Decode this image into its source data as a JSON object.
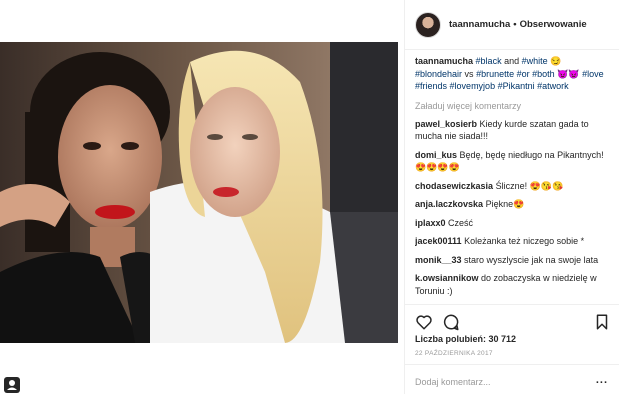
{
  "header": {
    "username": "taannamucha",
    "separator": "•",
    "follow_label": "Obserwowanie"
  },
  "caption": {
    "username": "taannamucha",
    "parts": [
      {
        "t": "tag",
        "v": "#black"
      },
      {
        "t": "text",
        "v": " and "
      },
      {
        "t": "tag",
        "v": "#white"
      },
      {
        "t": "text",
        "v": " 😏 "
      },
      {
        "t": "tag",
        "v": "#blondehair"
      },
      {
        "t": "text",
        "v": " vs "
      },
      {
        "t": "tag",
        "v": "#brunette"
      },
      {
        "t": "text",
        "v": " "
      },
      {
        "t": "tag",
        "v": "#or"
      },
      {
        "t": "text",
        "v": " "
      },
      {
        "t": "tag",
        "v": "#both"
      },
      {
        "t": "text",
        "v": " 😈👿 "
      },
      {
        "t": "tag",
        "v": "#love"
      },
      {
        "t": "text",
        "v": " "
      },
      {
        "t": "tag",
        "v": "#friends"
      },
      {
        "t": "text",
        "v": " "
      },
      {
        "t": "tag",
        "v": "#lovemyjob"
      },
      {
        "t": "text",
        "v": " "
      },
      {
        "t": "tag",
        "v": "#Pikantni"
      },
      {
        "t": "text",
        "v": " "
      },
      {
        "t": "tag",
        "v": "#atwork"
      }
    ]
  },
  "load_more_label": "Załaduj więcej komentarzy",
  "comments": [
    {
      "user": "pawel_kosierb",
      "text": "Kiedy kurde szatan gada to mucha nie siada!!!"
    },
    {
      "user": "domi_kus",
      "text": "Będę, będę niedługo na Pikantnych! 😍😍😍😍"
    },
    {
      "user": "chodasewiczkasia",
      "text": "Śliczne! 😍😘😘"
    },
    {
      "user": "anja.laczkovska",
      "text": "Piękne😍"
    },
    {
      "user": "iplaxx0",
      "text": "Cześć"
    },
    {
      "user": "jacek00111",
      "text": "Koleżanka też niczego sobie *"
    },
    {
      "user": "monik__33",
      "text": "staro wyszlyscie jak na swoje lata"
    },
    {
      "user": "k.owsiannikow",
      "text": "do zobaczyska w niedzielę w Toruniu :)"
    }
  ],
  "actions": {
    "icons": [
      "heart-icon",
      "comment-icon",
      "bookmark-icon"
    ],
    "likes_label": "Liczba polubień: 30 712",
    "date": "22 PAŹDZIERNIKA 2017"
  },
  "add_comment": {
    "placeholder": "Dodaj komentarz...",
    "more": "..."
  },
  "colors": {
    "hashtag": "#003569",
    "muted": "#999999",
    "text": "#262626",
    "border": "#efefef"
  }
}
